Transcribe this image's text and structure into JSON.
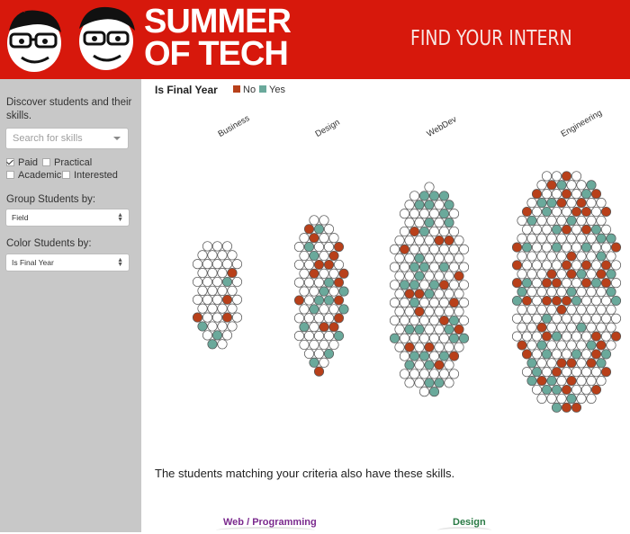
{
  "brand": {
    "line1": "SUMMER",
    "line2": "OF TECH",
    "tagline": "FIND YOUR INTERN",
    "bg_color": "#d7180c"
  },
  "sidebar": {
    "discover_text": "Discover students and their skills.",
    "search_placeholder": "Search for skills",
    "filters": [
      {
        "label": "Paid",
        "checked": true
      },
      {
        "label": "Practical",
        "checked": false
      },
      {
        "label": "Academic",
        "checked": false
      },
      {
        "label": "Interested",
        "checked": false
      }
    ],
    "group_label": "Group Students by:",
    "group_value": "Field",
    "color_label": "Color Students by:",
    "color_value": "Is Final Year"
  },
  "legend": {
    "title": "Is Final Year",
    "items": [
      {
        "label": "No",
        "color": "#b8401a"
      },
      {
        "label": "Yes",
        "color": "#6aa99b"
      }
    ]
  },
  "groups": [
    {
      "name": "Business"
    },
    {
      "name": "Design"
    },
    {
      "name": "WebDev"
    },
    {
      "name": "Engineering"
    }
  ],
  "skills_message": "The students matching your criteria also have these skills.",
  "skill_sections": [
    {
      "label": "Web / Programming",
      "color": "#7b2a8e"
    },
    {
      "label": "Design",
      "color": "#2a7a45"
    }
  ]
}
